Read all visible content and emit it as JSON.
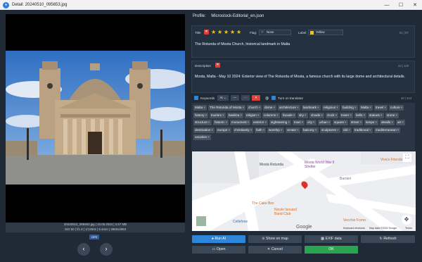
{
  "window": {
    "title": "Detail: 20240510_095653.jpg",
    "min": "—",
    "max": "☐",
    "close": "✕"
  },
  "left": {
    "file_line1": "20240510_095653.jpg | 10.05.2024 | 2.67 MB",
    "file_line2": "ISO 50 | f/1.8 | 1/1250s | 5.4mm | 3950x2963",
    "gps": "GPS",
    "prev": "‹",
    "next": "›"
  },
  "profile": {
    "label": "Profile:",
    "value": "Microstock-Editorial_en.json"
  },
  "title_section": {
    "label": "Title",
    "rating": 5,
    "flag_label": "Flag:",
    "flag_value": "None",
    "label_label": "Label:",
    "label_value": "Yellow",
    "label_color": "#f2c318",
    "counter": "51 | 57",
    "text": "The Rotunda of Mosta Church, historical landmark in Malta"
  },
  "description": {
    "label": "Description",
    "counter": "23 | 120",
    "text": "Mosta, Malta - May 10 2024: Exterior view of The Rotunda of Mosta, a famous church with its large dome and architectural details."
  },
  "keywords": {
    "label": "Keywords",
    "ai_label": "AI ⌄",
    "btn_minus": "—",
    "btn_dots": "···",
    "btn_x": "✕",
    "translator": "Turn on translator",
    "counter": "40 | 444",
    "tags": [
      "Malta",
      "The Rotunda of Mosta",
      "church",
      "dome",
      "architecture",
      "landmark",
      "religious",
      "building",
      "Malta",
      "travel",
      "culture",
      "history",
      "tourism",
      "basilica",
      "religion",
      "columns",
      "facade",
      "sky",
      "clouds",
      "clock",
      "tower",
      "bells",
      "statues",
      "stone",
      "structure",
      "historic",
      "monument",
      "exterior",
      "sightseeing",
      "town",
      "city",
      "urban",
      "square",
      "street",
      "lamps",
      "details",
      "art",
      "destination",
      "europe",
      "christianity",
      "faith",
      "worship",
      "ornate",
      "balcony",
      "sculptures",
      "old",
      "traditional",
      "mediterranean",
      "vacation"
    ]
  },
  "map": {
    "poi1": "Mosta Rotunda",
    "poi2": "Mosta World War II Shelter",
    "poi3": "Viva's Friends",
    "poi4": "The Cake Box",
    "poi5": "Nicolo Isouard Band Club",
    "poi6": "Cellefone",
    "poi7": "Vecchio Forno",
    "street": "Triq il-Kbira",
    "street2": "Barrieri",
    "google": "Google",
    "attrib1": "Keyboard shortcuts",
    "attrib2": "Map data ©2024 Google",
    "attrib3": "Terms"
  },
  "buttons": {
    "run_ai": "Run AI",
    "show_map": "Show on map",
    "exif": "EXIF data",
    "refresh": "Refresh",
    "open": "Open",
    "cancel": "Cancel",
    "ok": "OK"
  }
}
